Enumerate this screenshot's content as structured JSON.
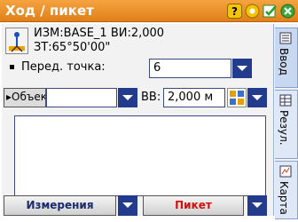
{
  "window": {
    "title": "Ход / пикет",
    "icons": [
      "help-icon",
      "settings-icon",
      "edit-icon",
      "close-icon"
    ]
  },
  "station": {
    "line1": "ИЗМ:BASE_1  ВИ:2,000",
    "line2": "ЗТ:65°50'00\""
  },
  "backsight": {
    "label": "Перед. точка:",
    "value": "6"
  },
  "object_row": {
    "label": "Объек",
    "value": "",
    "height_label": "ВВ:",
    "height_value": "2,000 м"
  },
  "notes_value": "",
  "buttons": {
    "measure": "Измерения",
    "stake": "Пикет"
  },
  "tabs": [
    "Ввод",
    "Резул.",
    "Карта"
  ],
  "colors": {
    "title_bar": "#e88a20",
    "dark_blue": "#223b8c",
    "stake_red": "#d01010"
  }
}
